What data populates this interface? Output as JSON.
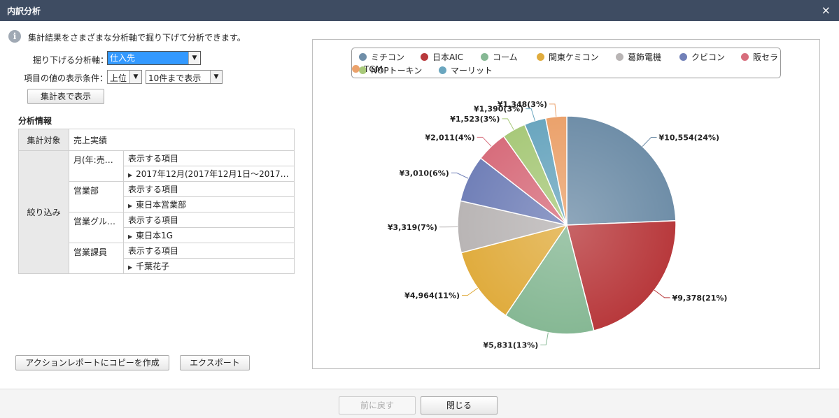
{
  "window": {
    "title": "内訳分析",
    "close_label": "×"
  },
  "info": {
    "text": "集計結果をさまざまな分析軸で掘り下げて分析できます。"
  },
  "form": {
    "axis_label": "掘り下げる分析軸：",
    "axis_value": "仕入先",
    "condition_label": "項目の値の表示条件：",
    "order_value": "上位",
    "limit_value": "10件まで表示",
    "show_table_button": "集計表で表示"
  },
  "analysis": {
    "section_title": "分析情報",
    "target_label": "集計対象",
    "target_value": "売上実績",
    "filter_label": "絞り込み",
    "filters": [
      {
        "name": "月(年:売…",
        "header": "表示する項目",
        "value": "2017年12月(2017年12月1日～2017…"
      },
      {
        "name": "営業部",
        "header": "表示する項目",
        "value": "東日本営業部"
      },
      {
        "name": "営業グル…",
        "header": "表示する項目",
        "value": "東日本1G"
      },
      {
        "name": "営業課員",
        "header": "表示する項目",
        "value": "千葉花子"
      }
    ]
  },
  "actions": {
    "copy_report": "アクションレポートにコピーを作成",
    "export": "エクスポート"
  },
  "footer": {
    "back": "前に戻す",
    "close": "閉じる"
  },
  "chart_data": {
    "type": "pie",
    "title": "",
    "series": [
      {
        "name": "ミチコン",
        "value": 10554,
        "label": "¥10,554(24%)",
        "color": "#6f8ea8"
      },
      {
        "name": "日本AIC",
        "value": 9378,
        "label": "¥9,378(21%)",
        "color": "#b8393c"
      },
      {
        "name": "コーム",
        "value": 5831,
        "label": "¥5,831(13%)",
        "color": "#86b894"
      },
      {
        "name": "関東ケミコン",
        "value": 4964,
        "label": "¥4,964(11%)",
        "color": "#e0ac3e"
      },
      {
        "name": "葛飾電機",
        "value": 3319,
        "label": "¥3,319(7%)",
        "color": "#b9b5b5"
      },
      {
        "name": "クビコン",
        "value": 3010,
        "label": "¥3,010(6%)",
        "color": "#7180b8"
      },
      {
        "name": "阪セラ",
        "value": 2011,
        "label": "¥2,011(4%)",
        "color": "#d76d7c"
      },
      {
        "name": "NOPトーキン",
        "value": 1523,
        "label": "¥1,523(3%)",
        "color": "#a8c97a"
      },
      {
        "name": "マーリット",
        "value": 1390,
        "label": "¥1,390(3%)",
        "color": "#6aa6bf"
      },
      {
        "name": "TGM",
        "value": 1348,
        "label": "¥1,348(3%)",
        "color": "#eba26c"
      }
    ],
    "legend_position": "top"
  }
}
